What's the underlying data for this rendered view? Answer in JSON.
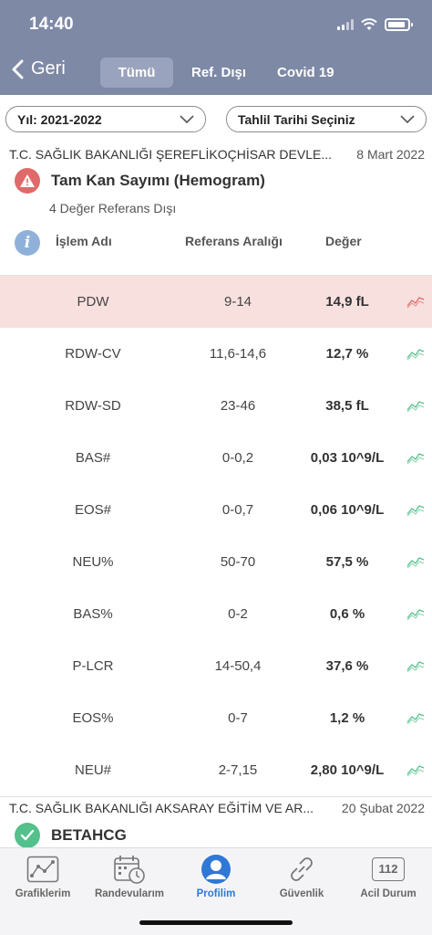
{
  "status": {
    "time": "14:40"
  },
  "header": {
    "back_label": "Geri",
    "tabs": [
      {
        "label": "Tümü",
        "active": true
      },
      {
        "label": "Ref. Dışı",
        "active": false
      },
      {
        "label": "Covid 19",
        "active": false
      }
    ]
  },
  "filters": {
    "year": "Yıl: 2021-2022",
    "date": "Tahlil Tarihi Seçiniz"
  },
  "results": [
    {
      "hospital": "T.C. SAĞLIK BAKANLIĞI ŞEREFLİKOÇHİSAR DEVLE...",
      "date": "8 Mart 2022",
      "test_name": "Tam Kan Sayımı (Hemogram)",
      "status": "warning",
      "subtitle": "4 Değer Referans Dışı",
      "columns": {
        "name": "İşlem Adı",
        "range": "Referans Aralığı",
        "value": "Değer"
      },
      "rows": [
        {
          "name": "PDW",
          "range": "9-14",
          "value": "14,9 fL",
          "out_of_range": true
        },
        {
          "name": "RDW-CV",
          "range": "11,6-14,6",
          "value": "12,7 %",
          "out_of_range": false
        },
        {
          "name": "RDW-SD",
          "range": "23-46",
          "value": "38,5 fL",
          "out_of_range": false
        },
        {
          "name": "BAS#",
          "range": "0-0,2",
          "value": "0,03 10^9/L",
          "out_of_range": false
        },
        {
          "name": "EOS#",
          "range": "0-0,7",
          "value": "0,06 10^9/L",
          "out_of_range": false
        },
        {
          "name": "NEU%",
          "range": "50-70",
          "value": "57,5 %",
          "out_of_range": false
        },
        {
          "name": "BAS%",
          "range": "0-2",
          "value": "0,6 %",
          "out_of_range": false
        },
        {
          "name": "P-LCR",
          "range": "14-50,4",
          "value": "37,6 %",
          "out_of_range": false
        },
        {
          "name": "EOS%",
          "range": "0-7",
          "value": "1,2 %",
          "out_of_range": false
        },
        {
          "name": "NEU#",
          "range": "2-7,15",
          "value": "2,80 10^9/L",
          "out_of_range": false
        }
      ]
    },
    {
      "hospital": "T.C. SAĞLIK BAKANLIĞI AKSARAY EĞİTİM VE AR...",
      "date": "20 Şubat 2022",
      "test_name": "BETAHCG",
      "status": "ok"
    }
  ],
  "bottom_nav": [
    {
      "label": "Grafiklerim",
      "icon": "chart-icon",
      "active": false
    },
    {
      "label": "Randevularım",
      "icon": "calendar-clock-icon",
      "active": false
    },
    {
      "label": "Profilim",
      "icon": "profile-icon",
      "active": true
    },
    {
      "label": "Güvenlik",
      "icon": "link-icon",
      "active": false
    },
    {
      "label": "Acil Durum",
      "icon": "emergency-112-icon",
      "icon_text": "112",
      "active": false
    }
  ],
  "colors": {
    "header": "#7e89a6",
    "highlight_row": "#f8e0df",
    "trend_red": "#e06a6a",
    "trend_green": "#54c08b",
    "active_nav": "#2f78d6"
  }
}
